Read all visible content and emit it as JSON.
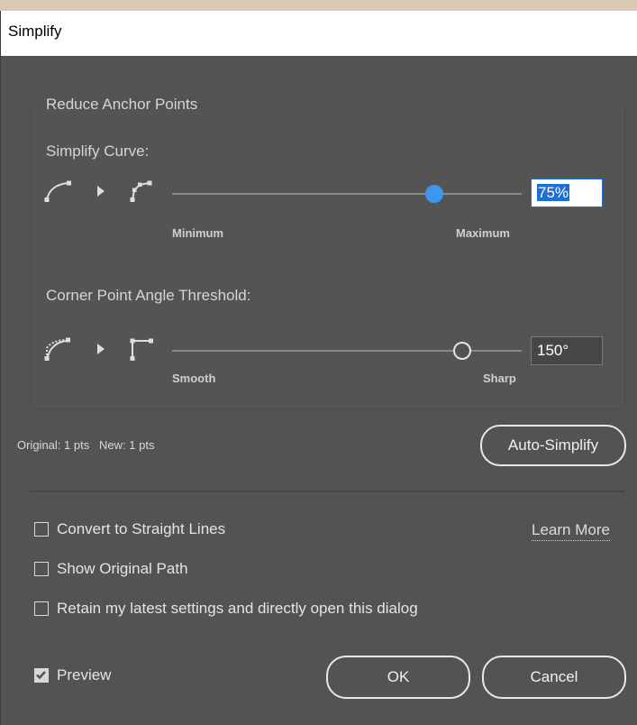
{
  "dialog": {
    "title": "Simplify"
  },
  "reduce_anchor_points": {
    "group_label": "Reduce Anchor Points",
    "simplify_curve": {
      "label": "Simplify Curve:",
      "min_label": "Minimum",
      "max_label": "Maximum",
      "value": "75%",
      "slider_fraction": 0.75
    },
    "corner_threshold": {
      "label": "Corner Point Angle Threshold:",
      "min_label": "Smooth",
      "max_label": "Sharp",
      "value": "150°",
      "slider_fraction": 0.83
    }
  },
  "points_info": "Original: 1 pts   New: 1 pts",
  "auto_simplify_label": "Auto-Simplify",
  "options": {
    "convert_straight": {
      "label": "Convert to Straight Lines",
      "checked": false
    },
    "show_original": {
      "label": "Show Original Path",
      "checked": false
    },
    "retain_settings": {
      "label": "Retain my latest settings and directly open this dialog",
      "checked": false
    },
    "learn_more": "Learn More"
  },
  "footer": {
    "preview": {
      "label": "Preview",
      "checked": true
    },
    "ok_label": "OK",
    "cancel_label": "Cancel"
  },
  "colors": {
    "dialog_bg": "#535353",
    "accent": "#3e97ef",
    "text": "#d5d5d5"
  }
}
